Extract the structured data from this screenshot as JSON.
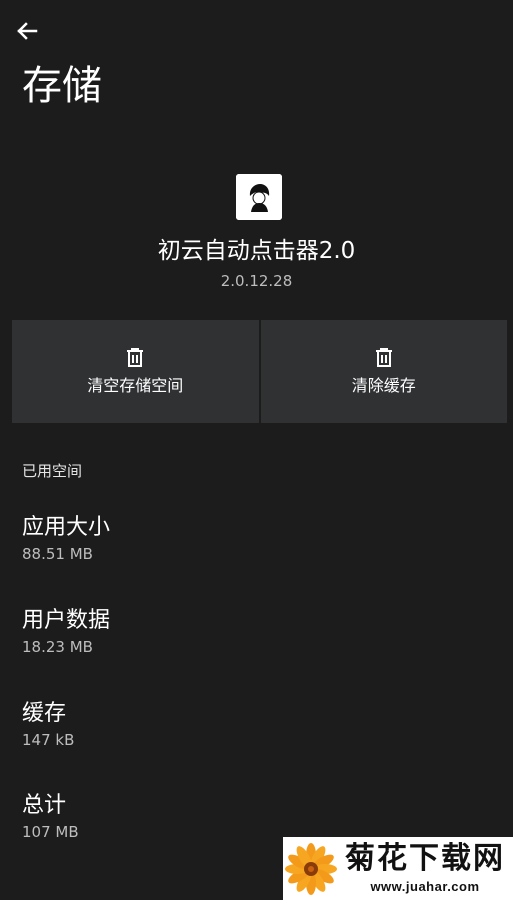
{
  "header": {
    "title": "存储"
  },
  "app": {
    "name": "初云自动点击器2.0",
    "version": "2.0.12.28"
  },
  "actions": {
    "clear_storage": "清空存储空间",
    "clear_cache": "清除缓存"
  },
  "storage": {
    "section_title": "已用空间",
    "items": [
      {
        "label": "应用大小",
        "value": "88.51 MB"
      },
      {
        "label": "用户数据",
        "value": "18.23 MB"
      },
      {
        "label": "缓存",
        "value": "147 kB"
      },
      {
        "label": "总计",
        "value": "107 MB"
      }
    ]
  },
  "watermark": {
    "title": "菊花下载网",
    "url": "www.juahar.com"
  },
  "icons": {
    "back": "arrow-left-icon",
    "app": "app-icon",
    "trash": "trash-icon"
  },
  "colors": {
    "background": "#1c1c1c",
    "button_background": "#2f3133",
    "secondary_text": "#bdbdbd"
  }
}
